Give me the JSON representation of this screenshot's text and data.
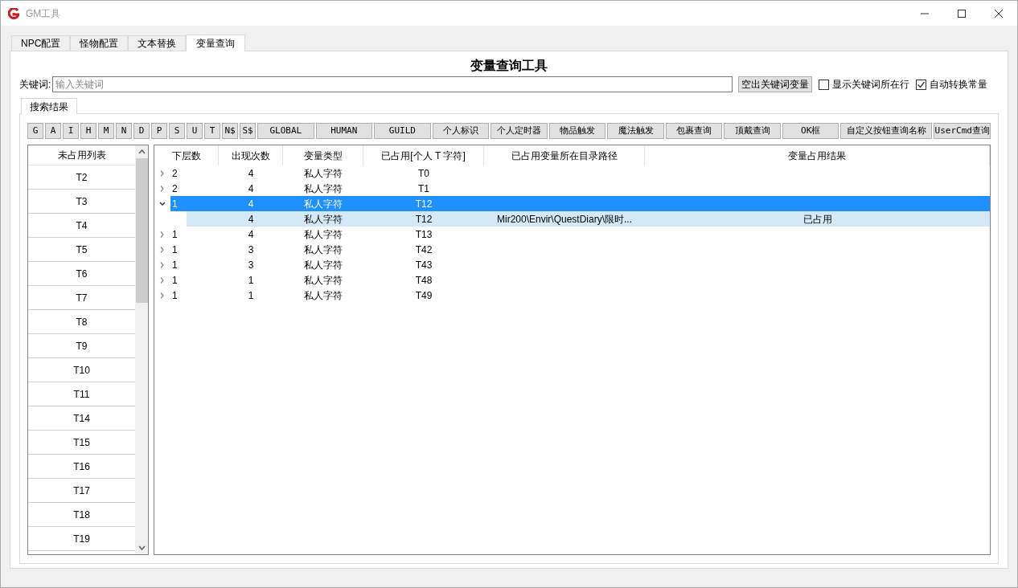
{
  "window": {
    "title": "GM工具"
  },
  "tabs": [
    {
      "label": "NPC配置",
      "selected": false
    },
    {
      "label": "怪物配置",
      "selected": false
    },
    {
      "label": "文本替换",
      "selected": false
    },
    {
      "label": "变量查询",
      "selected": true
    }
  ],
  "heading": "变量查询工具",
  "keyword": {
    "label": "关键词:",
    "placeholder": "输入关键词"
  },
  "extract_button": "空出关键词变量",
  "options": [
    {
      "label": "显示关键词所在行",
      "checked": false
    },
    {
      "label": "自动转换常量",
      "checked": true
    }
  ],
  "result_tabs": [
    {
      "label": "搜索结果",
      "selected": true
    }
  ],
  "filter_buttons": [
    {
      "label": "G",
      "kind": "short"
    },
    {
      "label": "A",
      "kind": "short"
    },
    {
      "label": "I",
      "kind": "short"
    },
    {
      "label": "H",
      "kind": "short"
    },
    {
      "label": "M",
      "kind": "short"
    },
    {
      "label": "N",
      "kind": "short"
    },
    {
      "label": "D",
      "kind": "short"
    },
    {
      "label": "P",
      "kind": "short"
    },
    {
      "label": "S",
      "kind": "short"
    },
    {
      "label": "U",
      "kind": "short"
    },
    {
      "label": "T",
      "kind": "short"
    },
    {
      "label": "N$",
      "kind": "short"
    },
    {
      "label": "S$",
      "kind": "short"
    },
    {
      "label": "GLOBAL",
      "kind": "wide"
    },
    {
      "label": "HUMAN",
      "kind": "wide"
    },
    {
      "label": "GUILD",
      "kind": "wide"
    },
    {
      "label": "个人标识",
      "kind": "wide"
    },
    {
      "label": "个人定时器",
      "kind": "wide"
    },
    {
      "label": "物品触发",
      "kind": "wide"
    },
    {
      "label": "魔法触发",
      "kind": "wide"
    },
    {
      "label": "包裹查询",
      "kind": "wide"
    },
    {
      "label": "顶戴查询",
      "kind": "wide"
    },
    {
      "label": "OK框",
      "kind": "wide"
    },
    {
      "label": "自定义按钮查询名称",
      "kind": "long"
    },
    {
      "label": "UserCmd查询",
      "kind": "wide"
    }
  ],
  "unused_list": {
    "header": "未占用列表",
    "items": [
      "T2",
      "T3",
      "T4",
      "T5",
      "T6",
      "T7",
      "T8",
      "T9",
      "T10",
      "T11",
      "T14",
      "T15",
      "T16",
      "T17",
      "T18",
      "T19"
    ]
  },
  "tree": {
    "columns": [
      "下层数",
      "出现次数",
      "变量类型",
      "已占用[个人 T 字符]",
      "已占用变量所在目录路径",
      "变量占用结果"
    ],
    "rows": [
      {
        "cells": [
          "2",
          "4",
          "私人字符",
          "T0",
          "",
          ""
        ],
        "expanded": false,
        "selected": false
      },
      {
        "cells": [
          "2",
          "4",
          "私人字符",
          "T1",
          "",
          ""
        ],
        "expanded": false,
        "selected": false
      },
      {
        "cells": [
          "1",
          "4",
          "私人字符",
          "T12",
          "",
          ""
        ],
        "expanded": true,
        "selected": true,
        "children": [
          {
            "cells": [
              "",
              "4",
              "私人字符",
              "T12",
              "Mir200\\Envir\\QuestDiary\\限时...",
              "已占用"
            ],
            "selected": false,
            "hovered": true
          }
        ]
      },
      {
        "cells": [
          "1",
          "4",
          "私人字符",
          "T13",
          "",
          ""
        ],
        "expanded": false,
        "selected": false
      },
      {
        "cells": [
          "1",
          "3",
          "私人字符",
          "T42",
          "",
          ""
        ],
        "expanded": false,
        "selected": false
      },
      {
        "cells": [
          "1",
          "3",
          "私人字符",
          "T43",
          "",
          ""
        ],
        "expanded": false,
        "selected": false
      },
      {
        "cells": [
          "1",
          "1",
          "私人字符",
          "T48",
          "",
          ""
        ],
        "expanded": false,
        "selected": false
      },
      {
        "cells": [
          "1",
          "1",
          "私人字符",
          "T49",
          "",
          ""
        ],
        "expanded": false,
        "selected": false
      }
    ]
  }
}
